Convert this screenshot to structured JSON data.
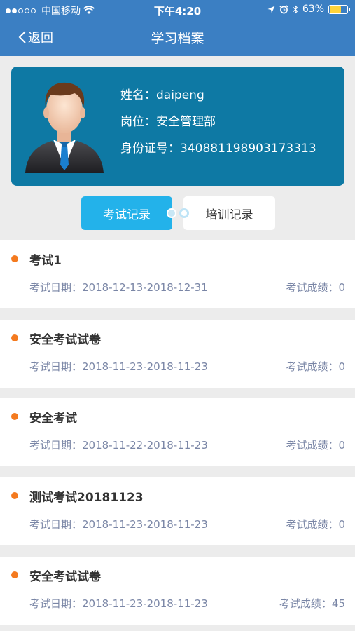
{
  "status_bar": {
    "carrier": "中国移动",
    "time": "下午4:20",
    "battery": "63%"
  },
  "nav": {
    "back_label": "返回",
    "title": "学习档案"
  },
  "profile": {
    "name_label": "姓名：",
    "name": "daipeng",
    "position_label": "岗位：",
    "position": "安全管理部",
    "id_label": "身份证号：",
    "id_number": "340881198903173313"
  },
  "tabs": [
    {
      "label": "考试记录",
      "active": true
    },
    {
      "label": "培训记录",
      "active": false
    }
  ],
  "records": [
    {
      "name": "考试1",
      "date_label": "考试日期：",
      "date": "2018-12-13-2018-12-31",
      "score_label": "考试成绩：",
      "score": "0"
    },
    {
      "name": "安全考试试卷",
      "date_label": "考试日期：",
      "date": "2018-11-23-2018-11-23",
      "score_label": "考试成绩：",
      "score": "0"
    },
    {
      "name": "安全考试",
      "date_label": "考试日期：",
      "date": "2018-11-22-2018-11-23",
      "score_label": "考试成绩：",
      "score": "0"
    },
    {
      "name": "测试考试20181123",
      "date_label": "考试日期：",
      "date": "2018-11-23-2018-11-23",
      "score_label": "考试成绩：",
      "score": "0"
    },
    {
      "name": "安全考试试卷",
      "date_label": "考试日期：",
      "date": "2018-11-23-2018-11-23",
      "score_label": "考试成绩：",
      "score": "45"
    }
  ],
  "colors": {
    "header": "#3b7fc3",
    "profile_card": "#0e79a4",
    "tab_active": "#23b2ea",
    "bullet": "#f47a1f"
  }
}
